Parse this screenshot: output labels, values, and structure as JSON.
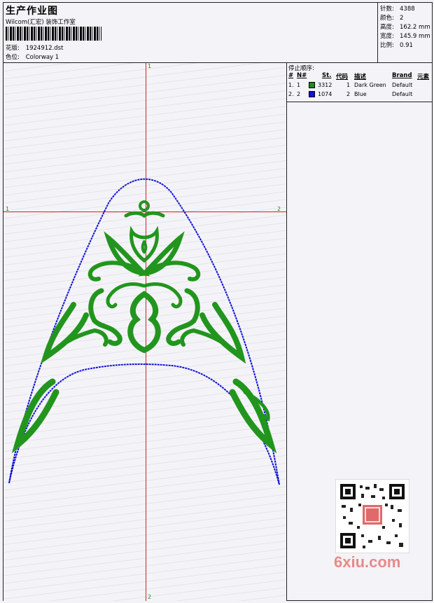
{
  "header": {
    "title": "生产作业图",
    "studio": "Wilcom(汇宏) 装饰工作室",
    "design_label": "花版:",
    "design_value": "1924912.dst",
    "colorway_label": "色位:",
    "colorway_value": "Colorway 1"
  },
  "stats": [
    {
      "label": "针数:",
      "value": "4388"
    },
    {
      "label": "颜色:",
      "value": "2"
    },
    {
      "label": "高度:",
      "value": "162.2 mm"
    },
    {
      "label": "宽度:",
      "value": "145.9 mm"
    },
    {
      "label": "比例:",
      "value": "0.91"
    }
  ],
  "guides": {
    "top": "1",
    "bottom": "2",
    "left": "1",
    "right": "2"
  },
  "stop_sequence": {
    "title": "停止顺序:",
    "columns": [
      "#",
      "N#",
      "St.",
      "代码",
      "描述",
      "Brand",
      "元素"
    ],
    "rows": [
      {
        "num": "1.",
        "n": "1",
        "color": "#1e8c1e",
        "st": "3312",
        "code": "1",
        "desc": "Dark Green",
        "brand": "Default"
      },
      {
        "num": "2.",
        "n": "2",
        "color": "#1010d8",
        "st": "1074",
        "code": "2",
        "desc": "Blue",
        "brand": "Default"
      }
    ]
  },
  "watermark": {
    "text": "6xiu.com"
  }
}
